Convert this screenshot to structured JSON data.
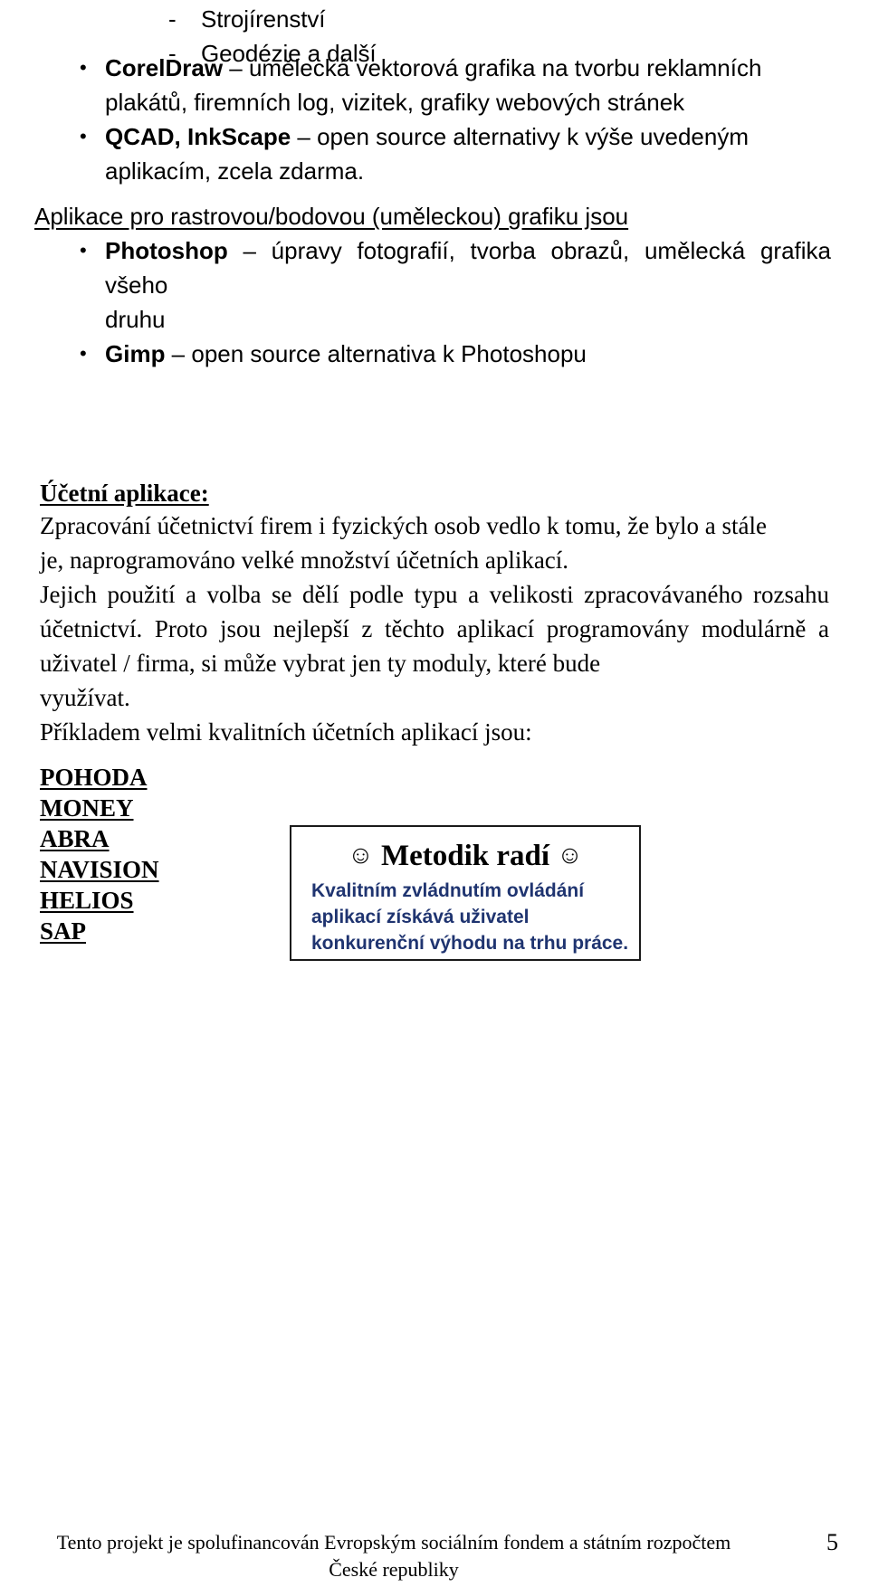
{
  "document": {
    "page_number": "5"
  },
  "top_dash_list": {
    "items": [
      {
        "marker": "-",
        "text": "Strojírenství"
      },
      {
        "marker": "-",
        "text": "Geodézie a další"
      }
    ]
  },
  "vector_bullets": {
    "items": [
      {
        "marker": "•",
        "bold": "CorelDraw",
        "text": " – umělecká vektorová grafika na tvorbu reklamních",
        "tail": "plakátů, firemních log, vizitek, grafiky webových stránek"
      },
      {
        "marker": "•",
        "bold": "QCAD, InkScape",
        "text": " – open source alternativy k výše uvedeným",
        "tail": "aplikacím, zcela zdarma."
      }
    ]
  },
  "raster_section": {
    "heading": "Aplikace pro rastrovou/bodovou (uměleckou) grafiku jsou",
    "items": [
      {
        "marker": "•",
        "bold": "Photoshop",
        "text": " – úpravy fotografií, tvorba obrazů, umělecká grafika všeho",
        "tail": "druhu"
      },
      {
        "marker": "•",
        "bold": "Gimp",
        "text": " – open source alternativa k Photoshopu",
        "tail": ""
      }
    ]
  },
  "accounting_section": {
    "heading": "Účetní aplikace:",
    "paragraph_1": "Zpracování účetnictví firem i fyzických osob vedlo k tomu, že bylo a stále",
    "paragraph_1_tail": "je, naprogramováno velké množství účetních aplikací.",
    "paragraph_2": "Jejich použití a volba se dělí podle typu a velikosti zpracovávaného rozsahu účetnictví. Proto jsou nejlepší z těchto aplikací programovány modulárně a uživatel / firma, si může vybrat jen ty moduly, které bude",
    "paragraph_2_tail": "využívat.",
    "paragraph_3": "Příkladem velmi kvalitních účetních aplikací jsou:",
    "apps": [
      "POHODA",
      "MONEY",
      "ABRA",
      "NAVISION",
      "HELIOS",
      "SAP"
    ]
  },
  "callout": {
    "smiley_left": "☺",
    "smiley_right": "☺",
    "title": "Metodik radí",
    "lines": [
      "Kvalitním zvládnutím ovládání",
      "aplikací získává uživatel",
      "konkurenční výhodu na trhu práce."
    ],
    "text_color": "#1f3470",
    "border_color": "#1a1a1a"
  },
  "footer": {
    "line_1": "Tento projekt je spolufinancován Evropským sociálním fondem a státním rozpočtem",
    "line_2": "České republiky"
  }
}
